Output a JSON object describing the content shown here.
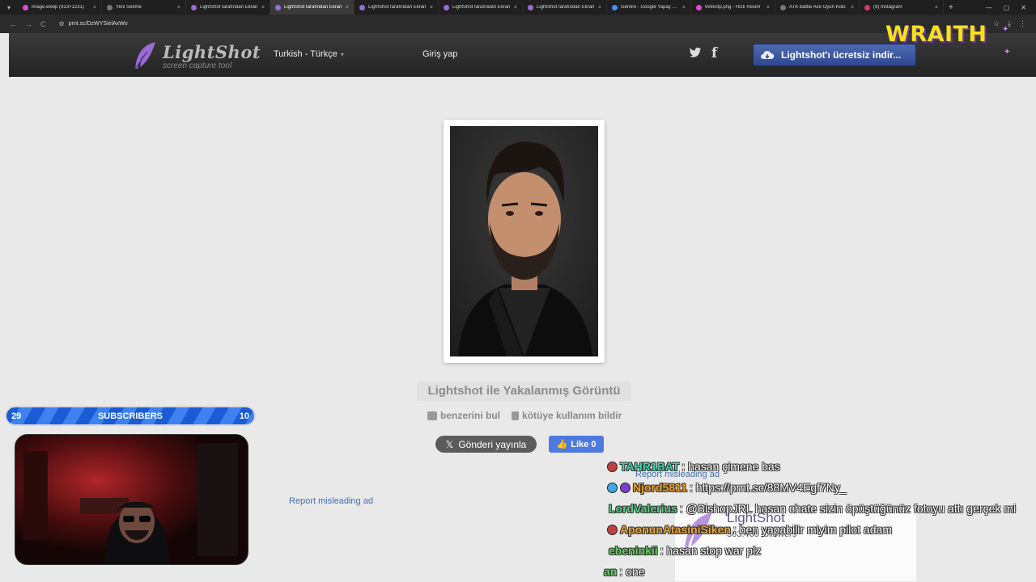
{
  "browser": {
    "tabs": [
      {
        "title": "image.webp (923×1231)",
        "icon": "image-icon",
        "active": false
      },
      {
        "title": "Yeni Sekme",
        "icon": "globe-icon",
        "active": false
      },
      {
        "title": "LightShot tarafından Ekran",
        "icon": "lightshot-icon",
        "active": false
      },
      {
        "title": "LightShot tarafından Ekran",
        "icon": "lightshot-icon",
        "active": true
      },
      {
        "title": "LightShot tarafından Ekran",
        "icon": "lightshot-icon",
        "active": false
      },
      {
        "title": "LightShot tarafından Ekran",
        "icon": "lightshot-icon",
        "active": false
      },
      {
        "title": "LightShot tarafından Ekran",
        "icon": "lightshot-icon",
        "active": false
      },
      {
        "title": "Gemini - Google Yapay Zeka",
        "icon": "gemini-icon",
        "active": false
      },
      {
        "title": "9v8vctp.png - Hızlı Resim",
        "icon": "image-icon",
        "active": false
      },
      {
        "title": "ATK Battle Axe Oyun Kolu",
        "icon": "globe-icon",
        "active": false
      },
      {
        "title": "(9) Instagram",
        "icon": "instagram-icon",
        "active": false
      }
    ],
    "tab_close": "×",
    "new_tab": "+",
    "url": "prnt.sc/DzWYSielAxWo",
    "nav_back": "←",
    "nav_forward": "→",
    "nav_reload": "C"
  },
  "header": {
    "logo_name": "LightShot",
    "logo_tagline": "screen capture tool",
    "language": "Turkish - Türkçe",
    "login": "Giriş yap",
    "download_button": "Lightshot'ı ücretsiz indir..."
  },
  "overlay": {
    "brand": "WRAITH"
  },
  "screenshot": {
    "caption": "Lightshot ile Yakalanmış Görüntü",
    "find_similar": "benzerini bul",
    "report_abuse": "kötüye kullanım bildir",
    "x_post": "Gönderi yayınla",
    "fb_like": "Like 0",
    "report_ad_left": "Report misleading ad",
    "report_ad_right": "Report misleading ad"
  },
  "stream": {
    "subs_left": "29",
    "subs_label": "SUBSCRIBERS",
    "subs_right": "10",
    "ad_title": "LightShot",
    "ad_followers": "363.460 followers"
  },
  "chat": [
    {
      "user": "TAHR1BAT",
      "color": "#3ed1a9",
      "message": ": hasan çimene bas"
    },
    {
      "user": "Njord5811",
      "color": "#f0a020",
      "message": ": https://prnt.sc/88MV4Egf7Ny_"
    },
    {
      "user": "LordValerius",
      "color": "#52d07e",
      "message": ": @BishopJRL hasan chate sizin öpüştüğünüz fotoyu attı gerçek mi"
    },
    {
      "user": "AponunAtasiniSiken",
      "color": "#e8a53a",
      "message": ": ben yapabilir miyim pilot adam"
    },
    {
      "user": "ebeninkii",
      "color": "#5fd35f",
      "message": ": hasan stop war plz"
    },
    {
      "user": "an",
      "color": "#5fd35f",
      "message": ": one"
    }
  ]
}
